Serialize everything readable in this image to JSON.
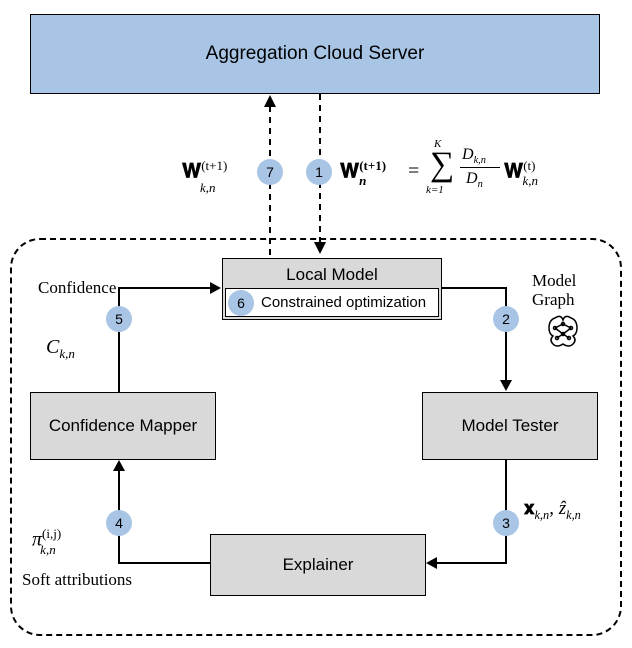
{
  "cloud": {
    "title": "Aggregation Cloud Server"
  },
  "local_model": {
    "title": "Local Model"
  },
  "constrained": {
    "title": "Constrained optimization"
  },
  "confidence_mapper": {
    "title": "Confidence Mapper"
  },
  "model_tester": {
    "title": "Model Tester"
  },
  "explainer": {
    "title": "Explainer"
  },
  "steps": {
    "s1": "1",
    "s2": "2",
    "s3": "3",
    "s4": "4",
    "s5": "5",
    "s6": "6",
    "s7": "7"
  },
  "labels": {
    "confidence": "Confidence",
    "model_graph": "Model Graph",
    "soft_attr": "Soft attributions"
  },
  "formulas": {
    "w_left": "𝐖",
    "w_left_sup": "(t+1)",
    "w_left_sub": "k,n",
    "w_right": "𝐖",
    "w_right_sup": "(t+1)",
    "w_right_sub": "n",
    "eq": " = ",
    "sum_upper": "K",
    "sum_lower": "k=1",
    "frac_top": "D",
    "frac_top_sub": "k,n",
    "frac_bot": "D",
    "frac_bot_sub": "n",
    "w_last": "𝐖",
    "w_last_sup": "(t)",
    "w_last_sub": "k,n",
    "C": "C",
    "C_sub": "k,n",
    "pi": "π",
    "pi_sup": "(i,j)",
    "pi_sub": "k,n",
    "x": "𝐱",
    "x_sub": "k,n",
    "comma": ", ",
    "z": "ẑ",
    "z_sub": "k,n"
  }
}
